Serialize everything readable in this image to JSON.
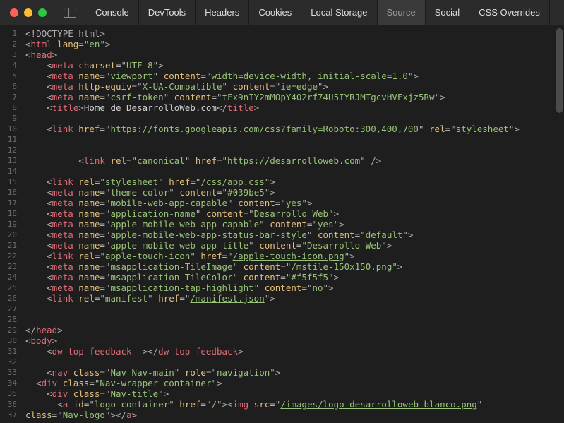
{
  "tabs": [
    "Console",
    "DevTools",
    "Headers",
    "Cookies",
    "Local Storage",
    "Source",
    "Social",
    "CSS Overrides"
  ],
  "activeTab": 5,
  "lines": [
    [
      [
        "punct",
        "<!"
      ],
      [
        "doctype",
        "DOCTYPE html"
      ],
      [
        "punct",
        ">"
      ]
    ],
    [
      [
        "punct",
        "<"
      ],
      [
        "tag",
        "html"
      ],
      [
        "text",
        " "
      ],
      [
        "attr",
        "lang"
      ],
      [
        "eq",
        "="
      ],
      [
        "punct",
        "\""
      ],
      [
        "str",
        "en"
      ],
      [
        "punct",
        "\">"
      ]
    ],
    [
      [
        "punct",
        "<"
      ],
      [
        "tag",
        "head"
      ],
      [
        "punct",
        ">"
      ]
    ],
    [
      [
        "text",
        "    "
      ],
      [
        "punct",
        "<"
      ],
      [
        "tag",
        "meta"
      ],
      [
        "text",
        " "
      ],
      [
        "attr",
        "charset"
      ],
      [
        "eq",
        "="
      ],
      [
        "punct",
        "\""
      ],
      [
        "str",
        "UTF-8"
      ],
      [
        "punct",
        "\">"
      ]
    ],
    [
      [
        "text",
        "    "
      ],
      [
        "punct",
        "<"
      ],
      [
        "tag",
        "meta"
      ],
      [
        "text",
        " "
      ],
      [
        "attr",
        "name"
      ],
      [
        "eq",
        "="
      ],
      [
        "punct",
        "\""
      ],
      [
        "str",
        "viewport"
      ],
      [
        "punct",
        "\" "
      ],
      [
        "attr",
        "content"
      ],
      [
        "eq",
        "="
      ],
      [
        "punct",
        "\""
      ],
      [
        "str",
        "width=device-width, initial-scale=1.0"
      ],
      [
        "punct",
        "\">"
      ]
    ],
    [
      [
        "text",
        "    "
      ],
      [
        "punct",
        "<"
      ],
      [
        "tag",
        "meta"
      ],
      [
        "text",
        " "
      ],
      [
        "attr",
        "http-equiv"
      ],
      [
        "eq",
        "="
      ],
      [
        "punct",
        "\""
      ],
      [
        "str",
        "X-UA-Compatible"
      ],
      [
        "punct",
        "\" "
      ],
      [
        "attr",
        "content"
      ],
      [
        "eq",
        "="
      ],
      [
        "punct",
        "\""
      ],
      [
        "str",
        "ie=edge"
      ],
      [
        "punct",
        "\">"
      ]
    ],
    [
      [
        "text",
        "    "
      ],
      [
        "punct",
        "<"
      ],
      [
        "tag",
        "meta"
      ],
      [
        "text",
        " "
      ],
      [
        "attr",
        "name"
      ],
      [
        "eq",
        "="
      ],
      [
        "punct",
        "\""
      ],
      [
        "str",
        "csrf-token"
      ],
      [
        "punct",
        "\" "
      ],
      [
        "attr",
        "content"
      ],
      [
        "eq",
        "="
      ],
      [
        "punct",
        "\""
      ],
      [
        "str",
        "tFx9nIY2mMOpY402rf74U5IYRJMTgcvHVFxjz5Rw"
      ],
      [
        "punct",
        "\">"
      ]
    ],
    [
      [
        "text",
        "    "
      ],
      [
        "punct",
        "<"
      ],
      [
        "tag",
        "title"
      ],
      [
        "punct",
        ">"
      ],
      [
        "text",
        "Home de DesarrolloWeb.com"
      ],
      [
        "punct",
        "</"
      ],
      [
        "tag",
        "title"
      ],
      [
        "punct",
        ">"
      ]
    ],
    [],
    [
      [
        "text",
        "    "
      ],
      [
        "punct",
        "<"
      ],
      [
        "tag",
        "link"
      ],
      [
        "text",
        " "
      ],
      [
        "attr",
        "href"
      ],
      [
        "eq",
        "="
      ],
      [
        "punct",
        "\""
      ],
      [
        "link",
        "https://fonts.googleapis.com/css?family=Roboto:300,400,700"
      ],
      [
        "punct",
        "\" "
      ],
      [
        "attr",
        "rel"
      ],
      [
        "eq",
        "="
      ],
      [
        "punct",
        "\""
      ],
      [
        "str",
        "stylesheet"
      ],
      [
        "punct",
        "\">"
      ]
    ],
    [],
    [],
    [
      [
        "text",
        "          "
      ],
      [
        "punct",
        "<"
      ],
      [
        "tag",
        "link"
      ],
      [
        "text",
        " "
      ],
      [
        "attr",
        "rel"
      ],
      [
        "eq",
        "="
      ],
      [
        "punct",
        "\""
      ],
      [
        "str",
        "canonical"
      ],
      [
        "punct",
        "\" "
      ],
      [
        "attr",
        "href"
      ],
      [
        "eq",
        "="
      ],
      [
        "punct",
        "\""
      ],
      [
        "link",
        "https://desarrolloweb.com"
      ],
      [
        "punct",
        "\" />"
      ]
    ],
    [],
    [
      [
        "text",
        "    "
      ],
      [
        "punct",
        "<"
      ],
      [
        "tag",
        "link"
      ],
      [
        "text",
        " "
      ],
      [
        "attr",
        "rel"
      ],
      [
        "eq",
        "="
      ],
      [
        "punct",
        "\""
      ],
      [
        "str",
        "stylesheet"
      ],
      [
        "punct",
        "\" "
      ],
      [
        "attr",
        "href"
      ],
      [
        "eq",
        "="
      ],
      [
        "punct",
        "\""
      ],
      [
        "link",
        "/css/app.css"
      ],
      [
        "punct",
        "\">"
      ]
    ],
    [
      [
        "text",
        "    "
      ],
      [
        "punct",
        "<"
      ],
      [
        "tag",
        "meta"
      ],
      [
        "text",
        " "
      ],
      [
        "attr",
        "name"
      ],
      [
        "eq",
        "="
      ],
      [
        "punct",
        "\""
      ],
      [
        "str",
        "theme-color"
      ],
      [
        "punct",
        "\" "
      ],
      [
        "attr",
        "content"
      ],
      [
        "eq",
        "="
      ],
      [
        "punct",
        "\""
      ],
      [
        "str",
        "#039be5"
      ],
      [
        "punct",
        "\">"
      ]
    ],
    [
      [
        "text",
        "    "
      ],
      [
        "punct",
        "<"
      ],
      [
        "tag",
        "meta"
      ],
      [
        "text",
        " "
      ],
      [
        "attr",
        "name"
      ],
      [
        "eq",
        "="
      ],
      [
        "punct",
        "\""
      ],
      [
        "str",
        "mobile-web-app-capable"
      ],
      [
        "punct",
        "\" "
      ],
      [
        "attr",
        "content"
      ],
      [
        "eq",
        "="
      ],
      [
        "punct",
        "\""
      ],
      [
        "str",
        "yes"
      ],
      [
        "punct",
        "\">"
      ]
    ],
    [
      [
        "text",
        "    "
      ],
      [
        "punct",
        "<"
      ],
      [
        "tag",
        "meta"
      ],
      [
        "text",
        " "
      ],
      [
        "attr",
        "name"
      ],
      [
        "eq",
        "="
      ],
      [
        "punct",
        "\""
      ],
      [
        "str",
        "application-name"
      ],
      [
        "punct",
        "\" "
      ],
      [
        "attr",
        "content"
      ],
      [
        "eq",
        "="
      ],
      [
        "punct",
        "\""
      ],
      [
        "str",
        "Desarrollo Web"
      ],
      [
        "punct",
        "\">"
      ]
    ],
    [
      [
        "text",
        "    "
      ],
      [
        "punct",
        "<"
      ],
      [
        "tag",
        "meta"
      ],
      [
        "text",
        " "
      ],
      [
        "attr",
        "name"
      ],
      [
        "eq",
        "="
      ],
      [
        "punct",
        "\""
      ],
      [
        "str",
        "apple-mobile-web-app-capable"
      ],
      [
        "punct",
        "\" "
      ],
      [
        "attr",
        "content"
      ],
      [
        "eq",
        "="
      ],
      [
        "punct",
        "\""
      ],
      [
        "str",
        "yes"
      ],
      [
        "punct",
        "\">"
      ]
    ],
    [
      [
        "text",
        "    "
      ],
      [
        "punct",
        "<"
      ],
      [
        "tag",
        "meta"
      ],
      [
        "text",
        " "
      ],
      [
        "attr",
        "name"
      ],
      [
        "eq",
        "="
      ],
      [
        "punct",
        "\""
      ],
      [
        "str",
        "apple-mobile-web-app-status-bar-style"
      ],
      [
        "punct",
        "\" "
      ],
      [
        "attr",
        "content"
      ],
      [
        "eq",
        "="
      ],
      [
        "punct",
        "\""
      ],
      [
        "str",
        "default"
      ],
      [
        "punct",
        "\">"
      ]
    ],
    [
      [
        "text",
        "    "
      ],
      [
        "punct",
        "<"
      ],
      [
        "tag",
        "meta"
      ],
      [
        "text",
        " "
      ],
      [
        "attr",
        "name"
      ],
      [
        "eq",
        "="
      ],
      [
        "punct",
        "\""
      ],
      [
        "str",
        "apple-mobile-web-app-title"
      ],
      [
        "punct",
        "\" "
      ],
      [
        "attr",
        "content"
      ],
      [
        "eq",
        "="
      ],
      [
        "punct",
        "\""
      ],
      [
        "str",
        "Desarrollo Web"
      ],
      [
        "punct",
        "\">"
      ]
    ],
    [
      [
        "text",
        "    "
      ],
      [
        "punct",
        "<"
      ],
      [
        "tag",
        "link"
      ],
      [
        "text",
        " "
      ],
      [
        "attr",
        "rel"
      ],
      [
        "eq",
        "="
      ],
      [
        "punct",
        "\""
      ],
      [
        "str",
        "apple-touch-icon"
      ],
      [
        "punct",
        "\" "
      ],
      [
        "attr",
        "href"
      ],
      [
        "eq",
        "="
      ],
      [
        "punct",
        "\""
      ],
      [
        "link",
        "/apple-touch-icon.png"
      ],
      [
        "punct",
        "\">"
      ]
    ],
    [
      [
        "text",
        "    "
      ],
      [
        "punct",
        "<"
      ],
      [
        "tag",
        "meta"
      ],
      [
        "text",
        " "
      ],
      [
        "attr",
        "name"
      ],
      [
        "eq",
        "="
      ],
      [
        "punct",
        "\""
      ],
      [
        "str",
        "msapplication-TileImage"
      ],
      [
        "punct",
        "\" "
      ],
      [
        "attr",
        "content"
      ],
      [
        "eq",
        "="
      ],
      [
        "punct",
        "\""
      ],
      [
        "str",
        "/mstile-150x150.png"
      ],
      [
        "punct",
        "\">"
      ]
    ],
    [
      [
        "text",
        "    "
      ],
      [
        "punct",
        "<"
      ],
      [
        "tag",
        "meta"
      ],
      [
        "text",
        " "
      ],
      [
        "attr",
        "name"
      ],
      [
        "eq",
        "="
      ],
      [
        "punct",
        "\""
      ],
      [
        "str",
        "msapplication-TileColor"
      ],
      [
        "punct",
        "\" "
      ],
      [
        "attr",
        "content"
      ],
      [
        "eq",
        "="
      ],
      [
        "punct",
        "\""
      ],
      [
        "str",
        "#f5f5f5"
      ],
      [
        "punct",
        "\">"
      ]
    ],
    [
      [
        "text",
        "    "
      ],
      [
        "punct",
        "<"
      ],
      [
        "tag",
        "meta"
      ],
      [
        "text",
        " "
      ],
      [
        "attr",
        "name"
      ],
      [
        "eq",
        "="
      ],
      [
        "punct",
        "\""
      ],
      [
        "str",
        "msapplication-tap-highlight"
      ],
      [
        "punct",
        "\" "
      ],
      [
        "attr",
        "content"
      ],
      [
        "eq",
        "="
      ],
      [
        "punct",
        "\""
      ],
      [
        "str",
        "no"
      ],
      [
        "punct",
        "\">"
      ]
    ],
    [
      [
        "text",
        "    "
      ],
      [
        "punct",
        "<"
      ],
      [
        "tag",
        "link"
      ],
      [
        "text",
        " "
      ],
      [
        "attr",
        "rel"
      ],
      [
        "eq",
        "="
      ],
      [
        "punct",
        "\""
      ],
      [
        "str",
        "manifest"
      ],
      [
        "punct",
        "\" "
      ],
      [
        "attr",
        "href"
      ],
      [
        "eq",
        "="
      ],
      [
        "punct",
        "\""
      ],
      [
        "link",
        "/manifest.json"
      ],
      [
        "punct",
        "\">"
      ]
    ],
    [],
    [],
    [
      [
        "punct",
        "</"
      ],
      [
        "tag",
        "head"
      ],
      [
        "punct",
        ">"
      ]
    ],
    [
      [
        "punct",
        "<"
      ],
      [
        "tag",
        "body"
      ],
      [
        "punct",
        ">"
      ]
    ],
    [
      [
        "text",
        "    "
      ],
      [
        "punct",
        "<"
      ],
      [
        "tag",
        "dw-top-feedback"
      ],
      [
        "text",
        "  "
      ],
      [
        "punct",
        "></"
      ],
      [
        "tag",
        "dw-top-feedback"
      ],
      [
        "punct",
        ">"
      ]
    ],
    [],
    [
      [
        "text",
        "    "
      ],
      [
        "punct",
        "<"
      ],
      [
        "tag",
        "nav"
      ],
      [
        "text",
        " "
      ],
      [
        "attr",
        "class"
      ],
      [
        "eq",
        "="
      ],
      [
        "punct",
        "\""
      ],
      [
        "str",
        "Nav Nav-main"
      ],
      [
        "punct",
        "\" "
      ],
      [
        "attr",
        "role"
      ],
      [
        "eq",
        "="
      ],
      [
        "punct",
        "\""
      ],
      [
        "str",
        "navigation"
      ],
      [
        "punct",
        "\">"
      ]
    ],
    [
      [
        "text",
        "  "
      ],
      [
        "punct",
        "<"
      ],
      [
        "tag",
        "div"
      ],
      [
        "text",
        " "
      ],
      [
        "attr",
        "class"
      ],
      [
        "eq",
        "="
      ],
      [
        "punct",
        "\""
      ],
      [
        "str",
        "Nav-wrapper container"
      ],
      [
        "punct",
        "\">"
      ]
    ],
    [
      [
        "text",
        "    "
      ],
      [
        "punct",
        "<"
      ],
      [
        "tag",
        "div"
      ],
      [
        "text",
        " "
      ],
      [
        "attr",
        "class"
      ],
      [
        "eq",
        "="
      ],
      [
        "punct",
        "\""
      ],
      [
        "str",
        "Nav-title"
      ],
      [
        "punct",
        "\">"
      ]
    ],
    [
      [
        "text",
        "      "
      ],
      [
        "punct",
        "<"
      ],
      [
        "tag",
        "a"
      ],
      [
        "text",
        " "
      ],
      [
        "attr",
        "id"
      ],
      [
        "eq",
        "="
      ],
      [
        "punct",
        "\""
      ],
      [
        "str",
        "logo-container"
      ],
      [
        "punct",
        "\" "
      ],
      [
        "attr",
        "href"
      ],
      [
        "eq",
        "="
      ],
      [
        "punct",
        "\""
      ],
      [
        "str",
        "/"
      ],
      [
        "punct",
        "\"><"
      ],
      [
        "tag",
        "img"
      ],
      [
        "text",
        " "
      ],
      [
        "attr",
        "src"
      ],
      [
        "eq",
        "="
      ],
      [
        "punct",
        "\""
      ],
      [
        "link",
        "/images/logo-desarrolloweb-blanco.png"
      ],
      [
        "punct",
        "\""
      ]
    ],
    [
      [
        "attr",
        "class"
      ],
      [
        "eq",
        "="
      ],
      [
        "punct",
        "\""
      ],
      [
        "str",
        "Nav-logo"
      ],
      [
        "punct",
        "\"></"
      ],
      [
        "tag",
        "a"
      ],
      [
        "punct",
        ">"
      ]
    ]
  ]
}
